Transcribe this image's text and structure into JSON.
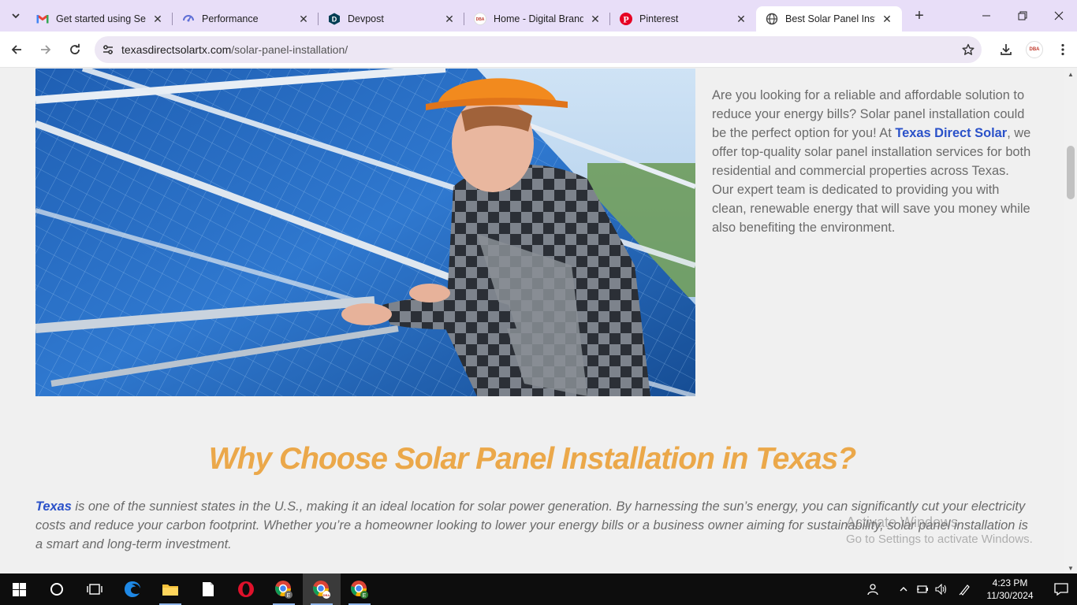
{
  "browser": {
    "tabs": [
      {
        "title": "Get started using Sea",
        "icon": "gmail-icon",
        "active": false
      },
      {
        "title": "Performance",
        "icon": "performance-icon",
        "active": false
      },
      {
        "title": "Devpost",
        "icon": "devpost-icon",
        "active": false
      },
      {
        "title": "Home - Digital Brand",
        "icon": "dba-icon",
        "active": false
      },
      {
        "title": "Pinterest",
        "icon": "pinterest-icon",
        "active": false
      },
      {
        "title": "Best Solar Panel Insta",
        "icon": "globe-icon",
        "active": true
      }
    ],
    "url_host": "texasdirectsolartx.com",
    "url_path": "/solar-panel-installation/",
    "profile_label": "DBA"
  },
  "page": {
    "intro_before": "Are you looking for a reliable and affordable solution to reduce your energy bills? Solar panel installation could be the perfect option for you! At ",
    "intro_link": "Texas Direct Solar",
    "intro_after": ", we offer top-quality solar panel installation services for both residential and commercial properties across Texas. Our expert team is dedicated to providing you with clean, renewable energy that will save you money while also benefiting the environment.",
    "heading": "Why Choose Solar Panel Installation in Texas?",
    "para_link": "Texas",
    "para_text": " is one of the sunniest states in the U.S., making it an ideal location for solar power generation. By harnessing the sun’s energy, you can significantly cut your electricity costs and reduce your carbon footprint. Whether you’re a homeowner looking to lower your energy bills or a business owner aiming for sustainability, solar panel installation is a smart and long-term investment."
  },
  "watermark": {
    "line1": "Activate Windows",
    "line2": "Go to Settings to activate Windows."
  },
  "taskbar": {
    "time": "4:23 PM",
    "date": "11/30/2024"
  }
}
